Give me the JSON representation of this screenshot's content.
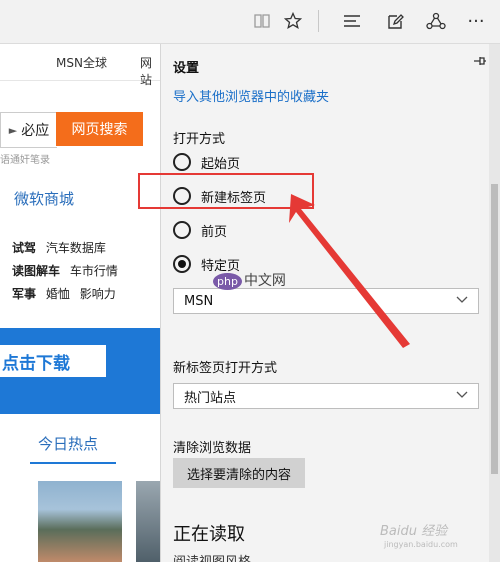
{
  "toolbar": {
    "icons": [
      "reading-view-icon",
      "favorite-star-icon",
      "hub-icon",
      "web-note-icon",
      "share-icon",
      "more-icon"
    ],
    "more_glyph": "···"
  },
  "page": {
    "nav": [
      "MSN全球",
      "网站"
    ],
    "search_engine_label": "必应",
    "search_button": "网页搜索",
    "hint": "语通奸笔录",
    "mall_label": "微软商城",
    "link_rows": [
      [
        "试驾",
        "汽车数据库"
      ],
      [
        "读图解车",
        "车市行情"
      ],
      [
        "军事",
        "婚恤",
        "影响力"
      ]
    ],
    "banner_button": "点击下载",
    "hot_tab": "今日热点"
  },
  "settings": {
    "title": "设置",
    "import_link": "导入其他浏览器中的收藏夹",
    "open_with_label": "打开方式",
    "open_options": [
      {
        "label": "起始页",
        "selected": false
      },
      {
        "label": "新建标签页",
        "selected": false
      },
      {
        "label": "前页",
        "selected": false
      },
      {
        "label": "特定页",
        "selected": true
      }
    ],
    "specific_page_value": "MSN",
    "new_tab_label": "新标签页打开方式",
    "new_tab_value": "热门站点",
    "clear_data_label": "清除浏览数据",
    "clear_button": "选择要清除的内容",
    "reading_title": "正在读取",
    "reading_sub": "阅读视图风格"
  },
  "watermarks": {
    "php": "php",
    "cn": "中文网",
    "baidu": "Baidu 经验",
    "baidu_sub": "jingyan.baidu.com"
  },
  "colors": {
    "accent": "#1e78d6",
    "search_orange": "#f46d1b",
    "highlight_red": "#e53935",
    "link_blue": "#1a6fc8"
  }
}
